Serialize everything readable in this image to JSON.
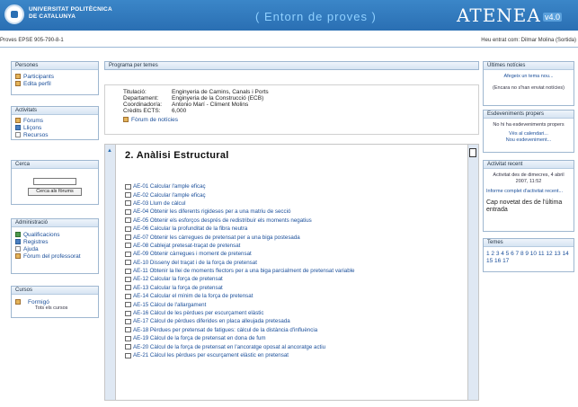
{
  "header": {
    "university_line1": "UNIVERSITAT POLITÈCNICA",
    "university_line2": "DE CATALUNYA",
    "environment": "( Entorn de proves )",
    "brand": "ATENEA",
    "version": "v4.0"
  },
  "breadcrumb": "Proves EPSE 905-790-8-1",
  "user_info": "Heu entrat com: Dilmar Molina (Sortida)",
  "left": {
    "persones": {
      "title": "Persones",
      "items": [
        "Participants",
        "Edita perfil"
      ]
    },
    "activitats": {
      "title": "Activitats",
      "items": [
        "Fòrums",
        "Lliçons",
        "Recursos"
      ]
    },
    "cerca": {
      "title": "Cerca",
      "button": "Cerca als fòrums"
    },
    "administracio": {
      "title": "Administració",
      "items": [
        "Qualificacions",
        "Registres",
        "Ajuda",
        "Fòrum del professorat"
      ]
    },
    "cursos": {
      "title": "Cursos",
      "course": "Formigó",
      "course_sub": "Tots els cursos"
    }
  },
  "main": {
    "header": "Programa per temes",
    "info": [
      {
        "k": "Titulació:",
        "v": "Enginyeria de Camins, Canals i Ports"
      },
      {
        "k": "Departament:",
        "v": "Enginyeria de la Construcció (ECB)"
      },
      {
        "k": "Coordinador/a:",
        "v": "Antonio Marí - Climent Molins"
      },
      {
        "k": "Crèdits ECTS:",
        "v": "6,000"
      }
    ],
    "news_forum": "Fòrum de notícies",
    "section_title": "2. Anàlisi Estructural",
    "activities": [
      "AE-01 Calcular l'ample eficaç",
      "AE-02 Calcular l'ample eficaç",
      "AE-03 Llum de càlcul",
      "AE-04 Obtenir les diferents rigideses per a una matriu de secció",
      "AE-05 Obtenir els esforços després de redistribuir els moments negatius",
      "AE-06 Calcular la profunditat de la fibra neutra",
      "AE-07 Obtenir les càrregues de pretensat per a una biga postesada",
      "AE-08 Cablejat pretesat-traçat de pretensat",
      "AE-09 Obtenir càrregues i moment de pretensat",
      "AE-10 Disseny del traçat i de la força de pretensat",
      "AE-11 Obtenir la llei de moments flectors per a una biga parcialment de pretensat variable",
      "AE-12 Calcular la força de pretensat",
      "AE-13 Calcular la força de pretensat",
      "AE-14 Calcular el mínim de la força de pretensat",
      "AE-15 Càlcul de l'allargament",
      "AE-16 Càlcul de les pèrdues per escurçament elàstic",
      "AE-17 Càlcul de pèrdues diferides en placa alleujada pretesada",
      "AE-18 Pèrdues per pretensat de fatigues: càlcul de la distància d'influència",
      "AE-19 Càlcul de la força de pretensat en dona de fum",
      "AE-20 Càlcul de la força de pretensat en l'ancoratge oposat al ancoratge actiu",
      "AE-21 Càlcul les pèrdues per escurçament elàstic en pretensat"
    ]
  },
  "right": {
    "noticies": {
      "title": "Últimes notícies",
      "line1": "Afegeix un tema nou...",
      "line2": "(Encara no s'han enviat notícies)"
    },
    "esdeveniments": {
      "title": "Esdeveniments propers",
      "line1": "No hi ha esdeveniments propers",
      "line2": "Vés al calendari...",
      "line3": "Nou esdeveniment..."
    },
    "activitat": {
      "title": "Activitat recent",
      "line1": "Activitat des de dimecres, 4 abril 2007, 11:52",
      "line2": "Informe complet d'activitat recent...",
      "line3": "Cap novetat des de l'última entrada"
    },
    "temes": {
      "title": "Temes",
      "numbers": "1 2 3 4 5 6 7 8 9 10 11 12 13 14 15 16 17"
    }
  }
}
